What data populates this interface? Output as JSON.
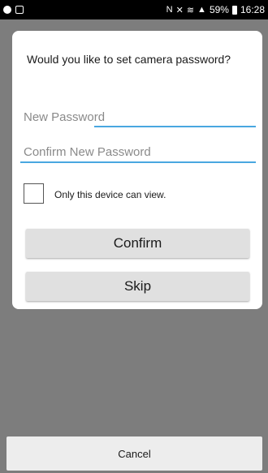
{
  "status_bar": {
    "left_icons": [
      "skype-icon",
      "image-icon"
    ],
    "right_icons": [
      "nfc-icon",
      "mute-icon",
      "wifi-icon",
      "signal-icon"
    ],
    "battery": "59%",
    "time": "16:28"
  },
  "dialog": {
    "title": "Would you like to set camera password?",
    "new_password_placeholder": "New Password",
    "confirm_password_placeholder": "Confirm New Password",
    "checkbox_label": "Only this device can view.",
    "checkbox_checked": false,
    "confirm_label": "Confirm",
    "skip_label": "Skip"
  },
  "cancel_label": "Cancel",
  "colors": {
    "accent": "#49a7e0",
    "button_bg": "#e0e0e0",
    "overlay": "#7d7d7d"
  }
}
